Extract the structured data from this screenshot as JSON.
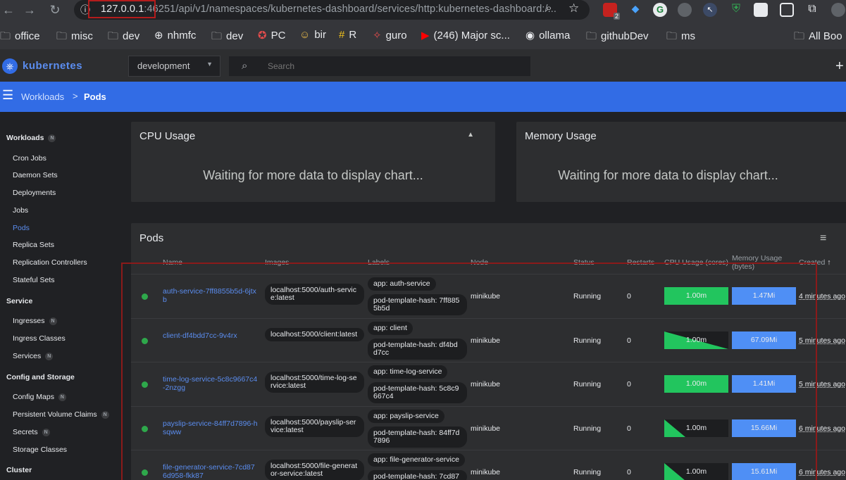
{
  "browser": {
    "url_prefix": "ⓘ",
    "url_host": "127.0.0.1",
    "url_rest": ":46251/api/v1/namespaces/kubernetes-dashboard/services/http:kubernetes-dashboard:/...",
    "ext_badge": "2",
    "bookmarks": [
      {
        "icon": "folder-icon",
        "label": "office"
      },
      {
        "icon": "folder-icon",
        "label": "misc"
      },
      {
        "icon": "folder-icon",
        "label": "dev"
      },
      {
        "icon": "globe-icon",
        "label": "nhmfc"
      },
      {
        "icon": "folder-icon",
        "label": "dev"
      },
      {
        "icon": "pc-icon",
        "label": "PC"
      },
      {
        "icon": "bir-icon",
        "label": "bir"
      },
      {
        "icon": "hash-icon",
        "label": "R"
      },
      {
        "icon": "guro-icon",
        "label": "guro"
      },
      {
        "icon": "youtube-icon",
        "label": "(246) Major sc..."
      },
      {
        "icon": "github-icon",
        "label": "ollama"
      },
      {
        "icon": "folder-icon",
        "label": "githubDev"
      },
      {
        "icon": "folder-icon",
        "label": "ms"
      },
      {
        "icon": "folder-icon",
        "label": "All Boo"
      }
    ]
  },
  "app": {
    "brand": "kubernetes",
    "namespace": "development",
    "search_placeholder": "Search"
  },
  "breadcrumb": {
    "parent": "Workloads",
    "separator": ">",
    "current": "Pods"
  },
  "sidebar": {
    "badge": "N",
    "sections": [
      {
        "heading": "Workloads",
        "badge": true,
        "items": [
          {
            "label": "Cron Jobs"
          },
          {
            "label": "Daemon Sets"
          },
          {
            "label": "Deployments"
          },
          {
            "label": "Jobs"
          },
          {
            "label": "Pods",
            "active": true
          },
          {
            "label": "Replica Sets"
          },
          {
            "label": "Replication Controllers"
          },
          {
            "label": "Stateful Sets"
          }
        ]
      },
      {
        "heading": "Service",
        "badge": false,
        "items": [
          {
            "label": "Ingresses",
            "badge": true
          },
          {
            "label": "Ingress Classes"
          },
          {
            "label": "Services",
            "badge": true
          }
        ]
      },
      {
        "heading": "Config and Storage",
        "badge": false,
        "items": [
          {
            "label": "Config Maps",
            "badge": true
          },
          {
            "label": "Persistent Volume Claims",
            "badge": true
          },
          {
            "label": "Secrets",
            "badge": true
          },
          {
            "label": "Storage Classes"
          }
        ]
      },
      {
        "heading": "Cluster",
        "badge": false,
        "items": []
      }
    ]
  },
  "cpu_card": {
    "title": "CPU Usage",
    "message": "Waiting for more data to display chart..."
  },
  "mem_card": {
    "title": "Memory Usage",
    "message": "Waiting for more data to display chart..."
  },
  "pods": {
    "title": "Pods",
    "columns": {
      "name": "Name",
      "images": "Images",
      "labels": "Labels",
      "node": "Node",
      "status": "Status",
      "restarts": "Restarts",
      "cpu": "CPU Usage (cores)",
      "memory_line1": "Memory Usage",
      "memory_line2": "(bytes)",
      "created": "Created",
      "sort_icon": "↑"
    },
    "rows": [
      {
        "name": "auth-service-7ff8855b5d-6jtxb",
        "image": "localhost:5000/auth-service:latest",
        "labels": [
          "app: auth-service",
          "pod-template-hash: 7ff8855b5d"
        ],
        "node": "minikube",
        "status": "Running",
        "restarts": "0",
        "cpu": "1.00m",
        "cpu_fill": 1.0,
        "cpu_shape": "full",
        "memory": "1.47Mi",
        "created": "4 minutes ago"
      },
      {
        "name": "client-df4bdd7cc-9v4rx",
        "image": "localhost:5000/client:latest",
        "labels": [
          "app: client",
          "pod-template-hash: df4bdd7cc"
        ],
        "node": "minikube",
        "status": "Running",
        "restarts": "0",
        "cpu": "1.00m",
        "cpu_fill": 1.0,
        "cpu_shape": "falling",
        "memory": "67.09Mi",
        "created": "5 minutes ago"
      },
      {
        "name": "time-log-service-5c8c9667c4-2nzgg",
        "image": "localhost:5000/time-log-service:latest",
        "labels": [
          "app: time-log-service",
          "pod-template-hash: 5c8c9667c4"
        ],
        "node": "minikube",
        "status": "Running",
        "restarts": "0",
        "cpu": "1.00m",
        "cpu_fill": 1.0,
        "cpu_shape": "full",
        "memory": "1.41Mi",
        "created": "5 minutes ago"
      },
      {
        "name": "payslip-service-84ff7d7896-hsqww",
        "image": "localhost:5000/payslip-service:latest",
        "labels": [
          "app: payslip-service",
          "pod-template-hash: 84ff7d7896"
        ],
        "node": "minikube",
        "status": "Running",
        "restarts": "0",
        "cpu": "1.00m",
        "cpu_fill": 1.0,
        "cpu_shape": "rising",
        "memory": "15.66Mi",
        "created": "6 minutes ago"
      },
      {
        "name": "file-generator-service-7cd876d958-fkk87",
        "image": "localhost:5000/file-generator-service:latest",
        "labels": [
          "app: file-generator-service",
          "pod-template-hash: 7cd87"
        ],
        "node": "minikube",
        "status": "Running",
        "restarts": "0",
        "cpu": "1.00m",
        "cpu_fill": 1.0,
        "cpu_shape": "rising",
        "memory": "15.61Mi",
        "created": "6 minutes ago"
      }
    ]
  }
}
